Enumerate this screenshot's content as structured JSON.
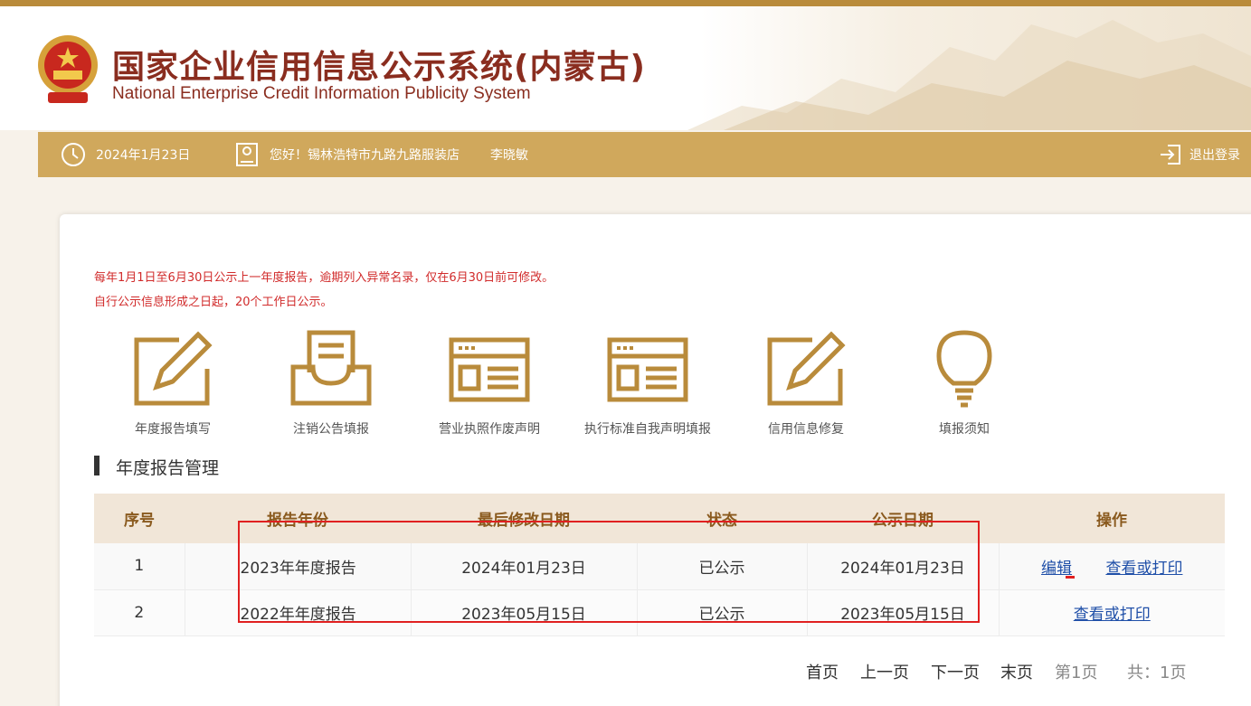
{
  "header": {
    "title": "国家企业信用信息公示系统(内蒙古)",
    "subtitle": "National Enterprise Credit Information Publicity System"
  },
  "navbar": {
    "date": "2024年1月23日",
    "greeting": "您好！锡林浩特市九路九路服装店",
    "user_name": "李晓敏",
    "logout_label": "退出登录"
  },
  "notices": [
    "每年1月1日至6月30日公示上一年度报告，逾期列入异常名录，仅在6月30日前可修改。",
    "自行公示信息形成之日起，20个工作日公示。"
  ],
  "functions": [
    {
      "label": "年度报告填写",
      "icon": "pen-edit-icon"
    },
    {
      "label": "注销公告填报",
      "icon": "inbox-document-icon"
    },
    {
      "label": "营业执照作废声明",
      "icon": "browser-window-icon"
    },
    {
      "label": "执行标准自我声明填报",
      "icon": "browser-window-icon"
    },
    {
      "label": "信用信息修复",
      "icon": "pen-edit-icon"
    },
    {
      "label": "填报须知",
      "icon": "lightbulb-icon"
    }
  ],
  "section_title": "年度报告管理",
  "table": {
    "headers": [
      "序号",
      "报告年份",
      "最后修改日期",
      "状态",
      "公示日期",
      "操作"
    ],
    "rows": [
      {
        "index": "1",
        "year": "2023年年度报告",
        "modified": "2024年01月23日",
        "status": "已公示",
        "publish": "2024年01月23日",
        "actions": [
          "编辑",
          "查看或打印"
        ]
      },
      {
        "index": "2",
        "year": "2022年年度报告",
        "modified": "2023年05月15日",
        "status": "已公示",
        "publish": "2023年05月15日",
        "actions": [
          "查看或打印"
        ]
      }
    ]
  },
  "pager": {
    "first": "首页",
    "prev": "上一页",
    "next": "下一页",
    "last": "末页",
    "current": "第1页",
    "total": "共：1页"
  },
  "colors": {
    "brand_gold": "#d0a85c",
    "title_red": "#8a2d1f",
    "notice_red": "#d12b2b",
    "link_blue": "#1f4fa8",
    "highlight_red": "#e02020"
  }
}
